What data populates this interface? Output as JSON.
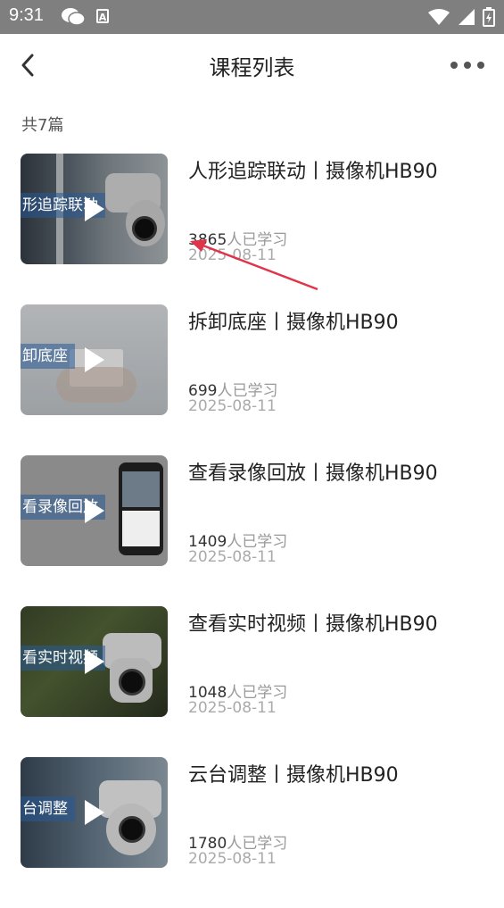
{
  "status_bar": {
    "time": "9:31",
    "a_badge": "A"
  },
  "nav": {
    "title": "课程列表"
  },
  "list_header": {
    "count_text": "共7篇"
  },
  "courses": [
    {
      "title": "人形追踪联动丨摄像机HB90",
      "learners_count": "3865",
      "learners_suffix": "人已学习",
      "date": "2025-08-11",
      "thumb_text": "形追踪联动"
    },
    {
      "title": "拆卸底座丨摄像机HB90",
      "learners_count": "699",
      "learners_suffix": "人已学习",
      "date": "2025-08-11",
      "thumb_text": "卸底座"
    },
    {
      "title": "查看录像回放丨摄像机HB90",
      "learners_count": "1409",
      "learners_suffix": "人已学习",
      "date": "2025-08-11",
      "thumb_text": "看录像回放"
    },
    {
      "title": "查看实时视频丨摄像机HB90",
      "learners_count": "1048",
      "learners_suffix": "人已学习",
      "date": "2025-08-11",
      "thumb_text": "看实时视频"
    },
    {
      "title": "云台调整丨摄像机HB90",
      "learners_count": "1780",
      "learners_suffix": "人已学习",
      "date": "2025-08-11",
      "thumb_text": "台调整"
    }
  ],
  "colors": {
    "status_bar": "#7f7f7f",
    "annotation_arrow": "#e0344a",
    "date_text": "#aaaaaa"
  },
  "icons": [
    "back-arrow-icon",
    "more-dots-icon",
    "play-icon",
    "wechat-icon",
    "wifi-icon",
    "signal-icon",
    "battery-icon"
  ]
}
